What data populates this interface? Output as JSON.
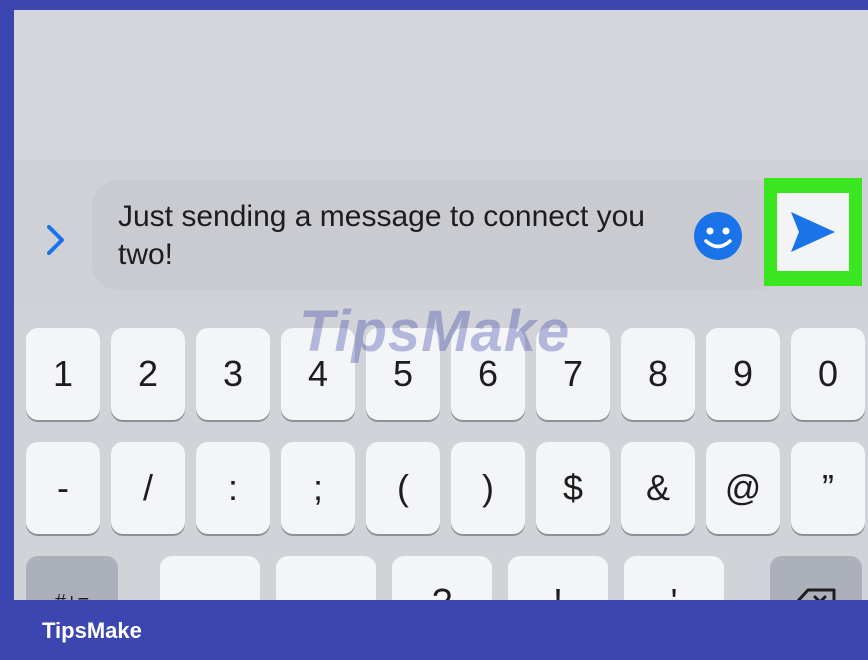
{
  "compose": {
    "message": "Just sending a message to connect you two!",
    "send_highlight_color": "#39e620",
    "accent_color": "#1a73e8"
  },
  "keyboard": {
    "row1": [
      "1",
      "2",
      "3",
      "4",
      "5",
      "6",
      "7",
      "8",
      "9",
      "0"
    ],
    "row2": [
      "-",
      "/",
      ":",
      ";",
      "(",
      ")",
      "$",
      "&",
      "@",
      "”"
    ],
    "row3": [
      "#+=",
      "",
      "",
      "?",
      "!",
      "'",
      ""
    ]
  },
  "watermark": "TipsMake",
  "brand": "TipsMake",
  "icons": [
    "chevron-right-icon",
    "emoji-icon",
    "send-icon",
    "delete-icon"
  ]
}
